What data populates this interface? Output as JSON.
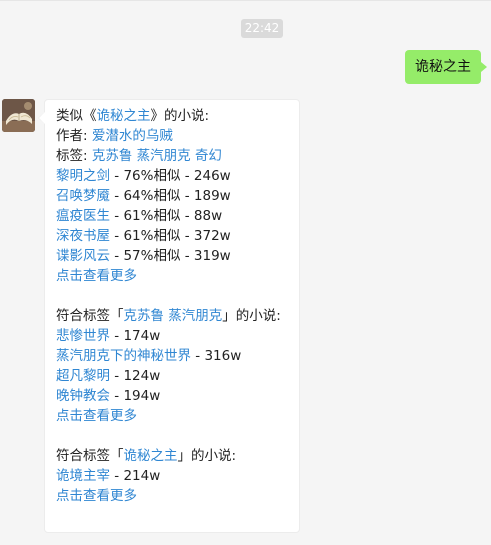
{
  "time": "22:42",
  "user_message": "诡秘之主",
  "reply": {
    "similar": {
      "prefix": "类似《",
      "title": "诡秘之主",
      "suffix": "》的小说:",
      "author_label": "作者: ",
      "author": "爱潜水的乌贼",
      "tags_label": "标签: ",
      "tags": [
        "克苏鲁",
        "蒸汽朋克",
        "奇幻"
      ],
      "items": [
        {
          "name": "黎明之剑",
          "info": " - 76%相似 - 246w"
        },
        {
          "name": "召唤梦魇",
          "info": " - 64%相似 - 189w"
        },
        {
          "name": "瘟疫医生",
          "info": " - 61%相似 - 88w"
        },
        {
          "name": "深夜书屋",
          "info": " - 61%相似 - 372w"
        },
        {
          "name": "谍影风云",
          "info": " - 57%相似 - 319w"
        }
      ],
      "more": "点击查看更多"
    },
    "by_tags": {
      "prefix": "符合标签「",
      "tag": "克苏鲁 蒸汽朋克",
      "suffix": "」的小说:",
      "items": [
        {
          "name": "悲惨世界",
          "info": " - 174w"
        },
        {
          "name": "蒸汽朋克下的神秘世界",
          "info": " - 316w"
        },
        {
          "name": "超凡黎明",
          "info": " - 124w"
        },
        {
          "name": "晚钟教会",
          "info": " - 194w"
        }
      ],
      "more": "点击查看更多"
    },
    "by_tag2": {
      "prefix": "符合标签「",
      "tag": "诡秘之主",
      "suffix": "」的小说:",
      "items": [
        {
          "name": "诡境主宰",
          "info": " - 214w"
        }
      ],
      "more": "点击查看更多"
    }
  }
}
